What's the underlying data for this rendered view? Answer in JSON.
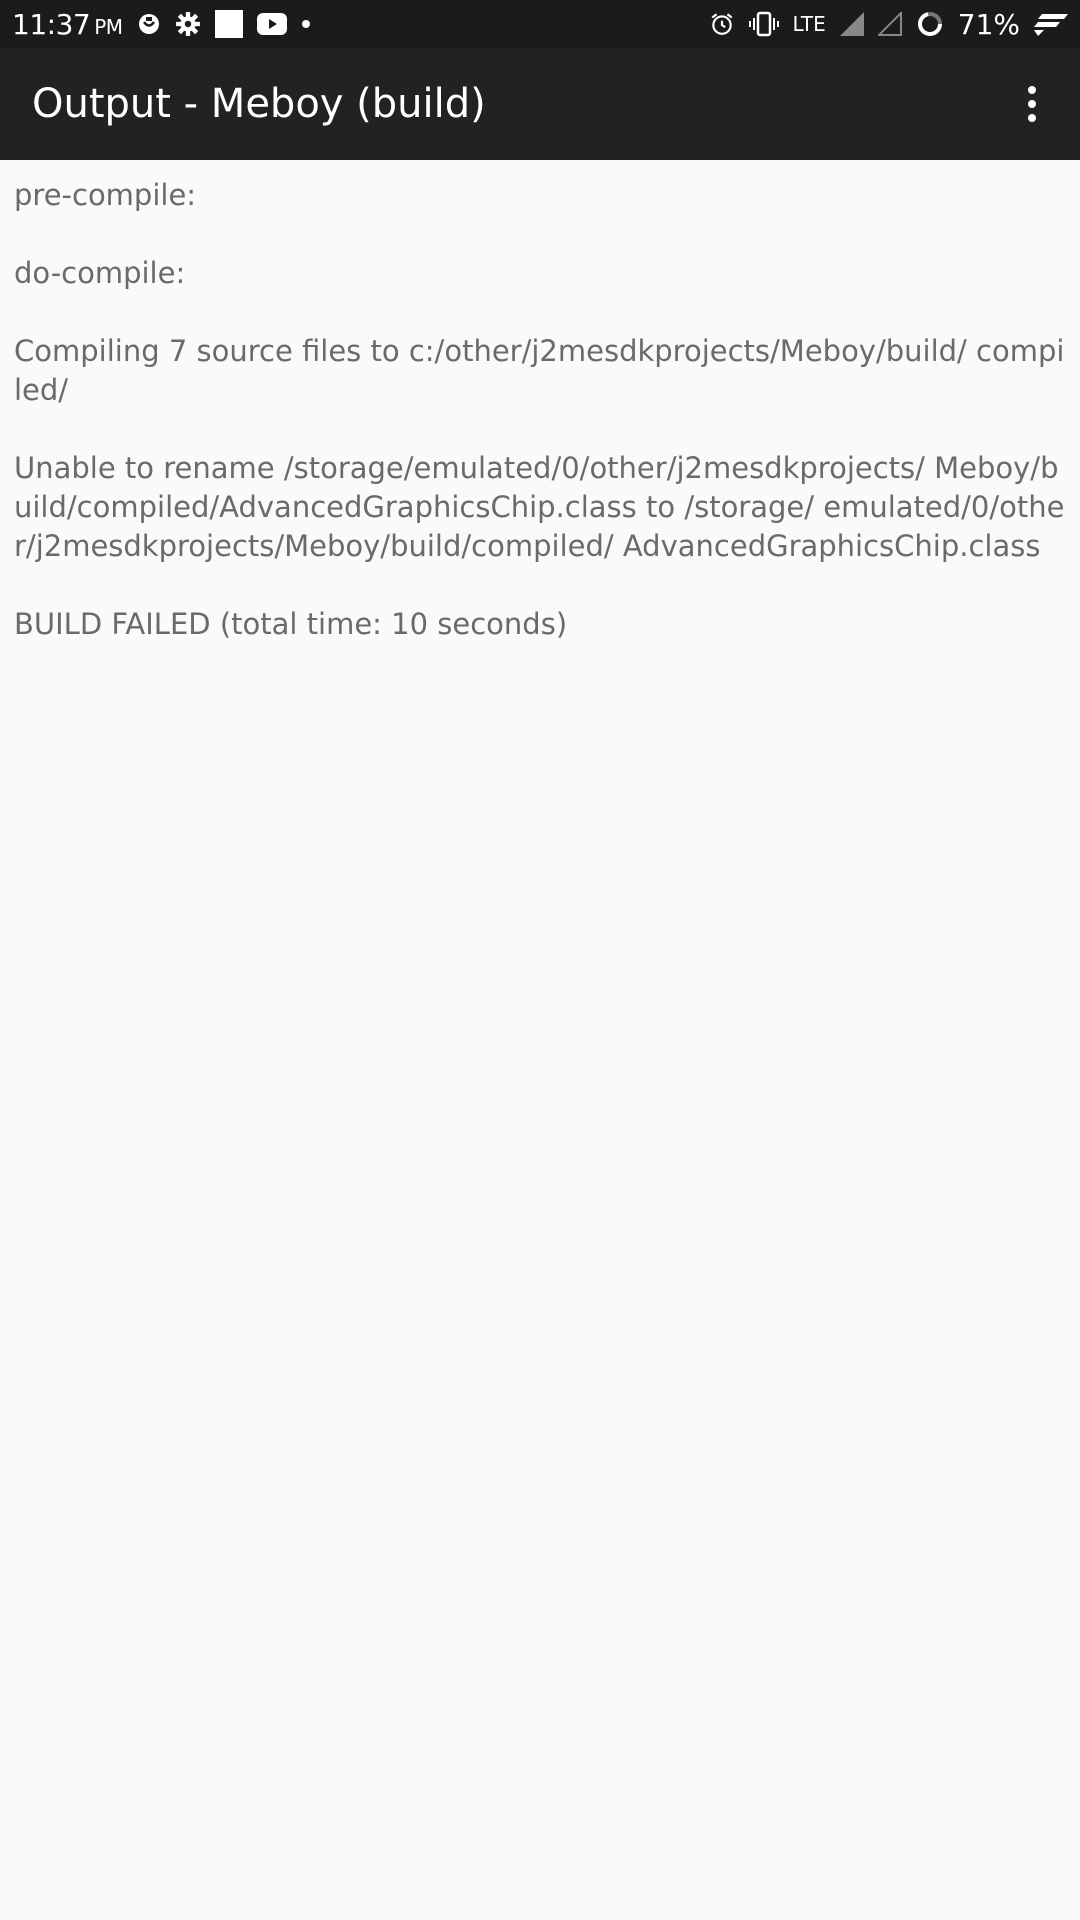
{
  "status_bar": {
    "time": "11:37",
    "ampm": "PM",
    "network": "LTE",
    "battery": "71%",
    "icons": [
      "notification-app-icon",
      "settings-icon",
      "square-notification-icon",
      "youtube-icon",
      "dot-icon",
      "alarm-icon",
      "vibrate-icon",
      "signal-icon",
      "signal-empty-icon",
      "battery-ring-icon",
      "flash-icon"
    ]
  },
  "app_bar": {
    "title": "Output - Meboy (build)",
    "menu_icon": "more-vert-icon"
  },
  "output": {
    "lines": [
      "pre-compile:",
      "do-compile:",
      "Compiling 7 source files to c:/other/j2mesdkprojects/Meboy/build/ compiled/",
      "Unable to rename /storage/emulated/0/other/j2mesdkprojects/ Meboy/build/compiled/AdvancedGraphicsChip.class to /storage/ emulated/0/other/j2mesdkprojects/Meboy/build/compiled/ AdvancedGraphicsChip.class",
      "BUILD FAILED (total time: 10 seconds)"
    ]
  }
}
